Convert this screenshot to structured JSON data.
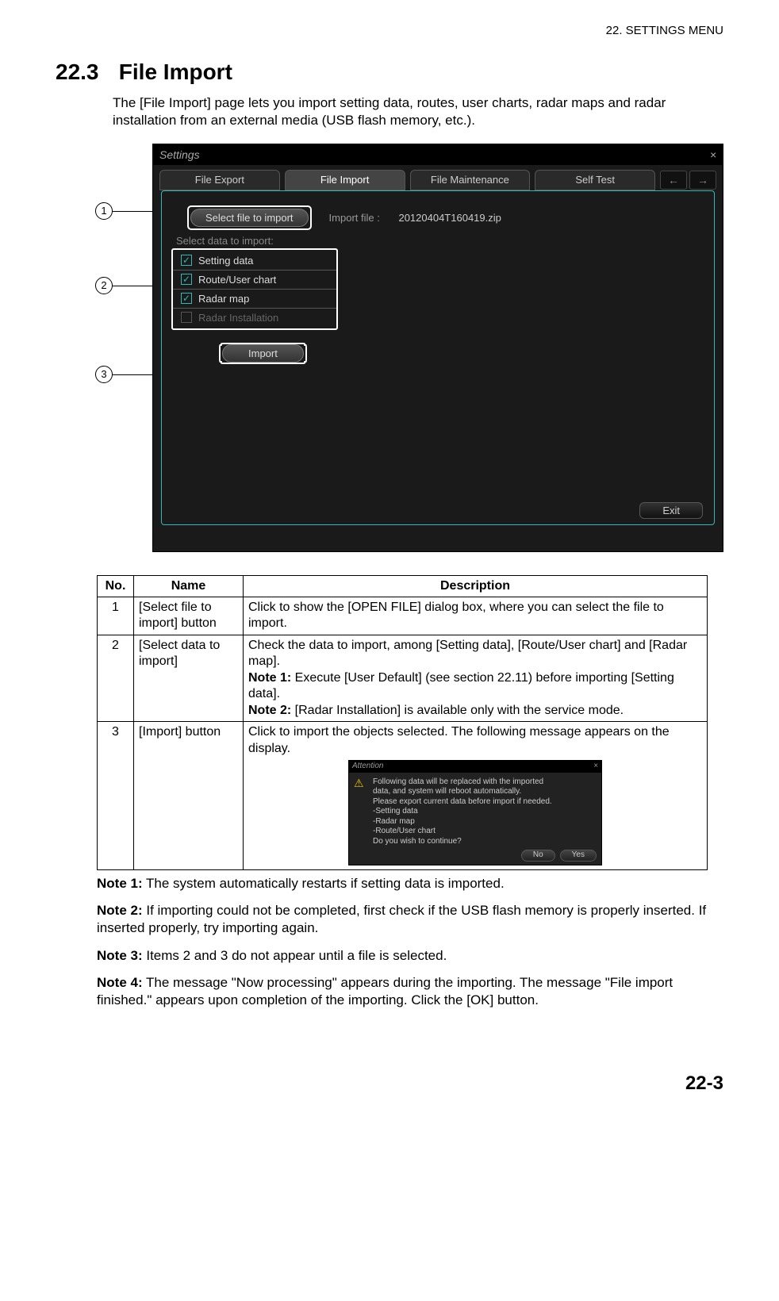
{
  "chapter_header": "22.  SETTINGS MENU",
  "section": {
    "number": "22.3",
    "title": "File Import"
  },
  "intro": "The [File Import] page lets you import setting data, routes, user charts, radar maps and radar installation from an external media (USB flash memory, etc.).",
  "callouts": {
    "c1": "1",
    "c2": "2",
    "c3": "3"
  },
  "app": {
    "title": "Settings",
    "close": "×",
    "tabs": {
      "export": "File Export",
      "import": "File Import",
      "maint": "File Maintenance",
      "selftest": "Self Test",
      "prev": "←",
      "next": "→"
    },
    "select_file_btn": "Select file to import",
    "import_file_label": "Import file :",
    "import_file_name": "20120404T160419.zip",
    "data_group_title": "Select data to import:",
    "items": {
      "setting": "Setting data",
      "route": "Route/User chart",
      "radar_map": "Radar map",
      "radar_install": "Radar Installation"
    },
    "import_btn": "Import",
    "exit_btn": "Exit"
  },
  "table": {
    "headers": {
      "no": "No.",
      "name": "Name",
      "desc": "Description"
    },
    "r1": {
      "no": "1",
      "name": "[Select file to import] button",
      "desc": "Click to show the [OPEN FILE] dialog box, where you can select the file to import."
    },
    "r2": {
      "no": "2",
      "name": "[Select data to import]",
      "line1": "Check the data to import, among [Setting data], [Route/User chart] and [Radar map].",
      "note1b": "Note 1:",
      "note1": " Execute [User Default] (see section 22.11) before importing [Setting data].",
      "note2b": "Note 2:",
      "note2": " [Radar Installation] is available only with the service mode."
    },
    "r3": {
      "no": "3",
      "name": "[Import] button",
      "line": "Click to import the objects selected. The following message appears on the display."
    }
  },
  "dialog": {
    "title": "Attention",
    "close": "×",
    "l1": "Following data will be replaced with the imported",
    "l2": "data, and system will reboot automatically.",
    "l3": "Please export current data before import if needed.",
    "l4": "-Setting data",
    "l5": "-Radar map",
    "l6": "-Route/User chart",
    "l7": "Do you wish to continue?",
    "no": "No",
    "yes": "Yes"
  },
  "notes": {
    "n1b": "Note 1:",
    "n1": " The system automatically restarts if setting data is imported.",
    "n2b": "Note 2:",
    "n2": " If importing could not be completed, first check if the USB flash memory is properly inserted. If inserted properly, try importing again.",
    "n3b": "Note 3:",
    "n3": " Items 2 and 3 do not appear until a file is selected.",
    "n4b": "Note 4:",
    "n4": " The message \"Now processing\" appears during the importing. The message \"File import finished.\" appears upon completion of the importing. Click the [OK] button."
  },
  "page_number": "22-3",
  "checkmark": "✓"
}
